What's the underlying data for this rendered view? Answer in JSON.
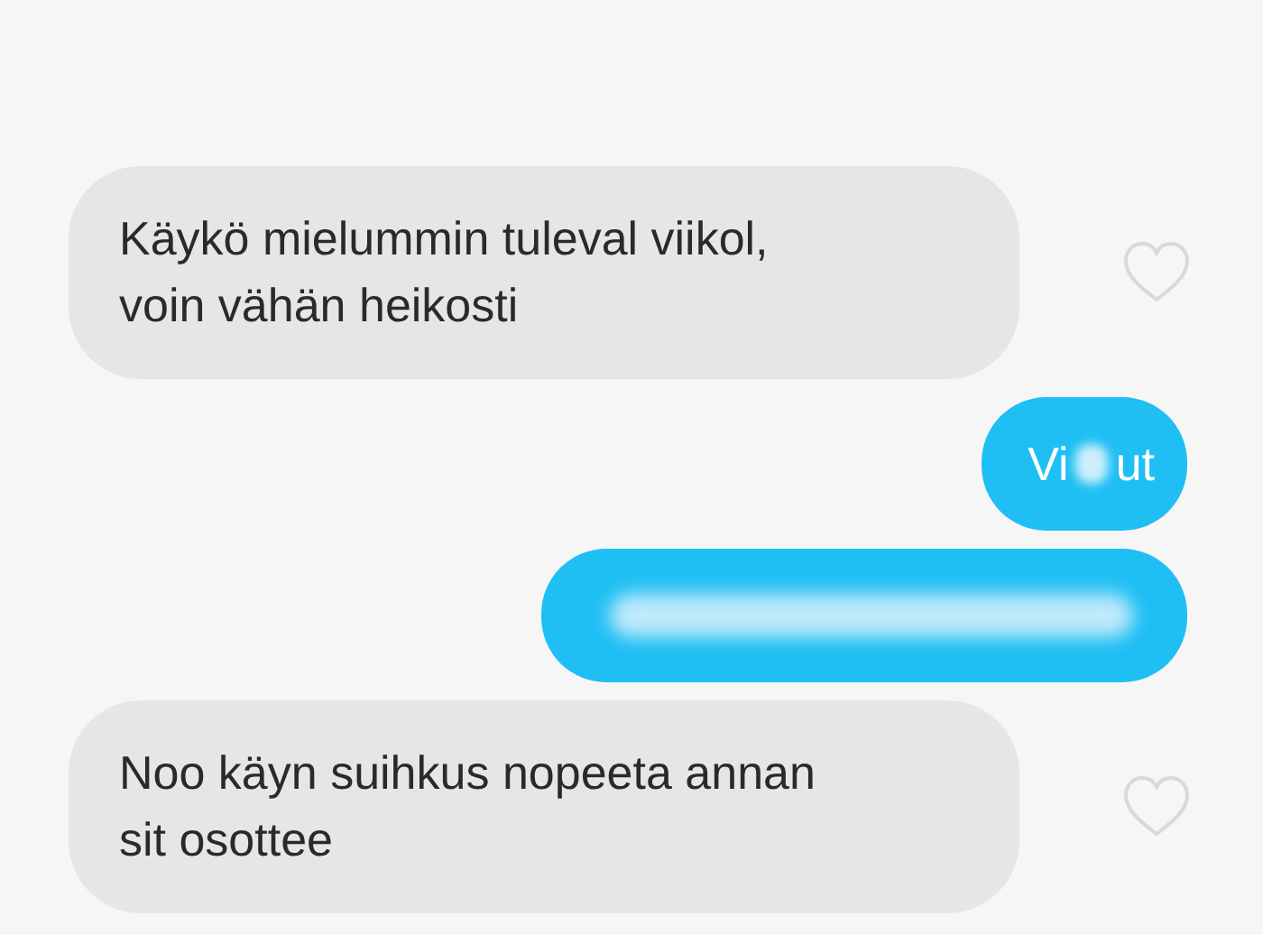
{
  "messages": [
    {
      "kind": "received",
      "lines": [
        "Käykö mielummin tuleval viikol,",
        "voin vähän heikosti"
      ],
      "liked": false
    },
    {
      "kind": "sent",
      "parts": [
        "Vi",
        "ut"
      ]
    },
    {
      "kind": "sent_redacted"
    },
    {
      "kind": "received",
      "lines": [
        "Noo käyn suihkus nopeeta annan",
        "sit osottee"
      ],
      "liked": false
    }
  ]
}
